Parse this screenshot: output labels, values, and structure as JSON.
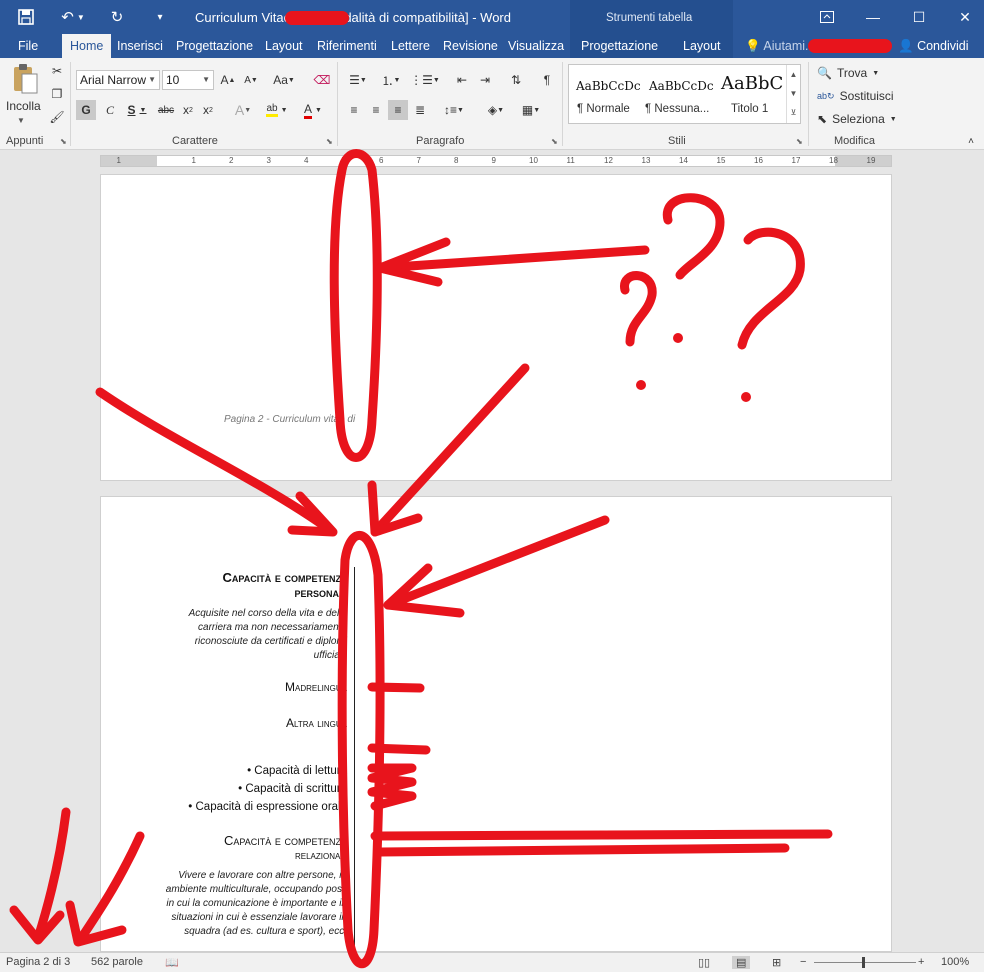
{
  "window": {
    "title": "Curriculum Vitae            .doc [Modalità di compatibilità] - Word",
    "context_title": "Strumenti tabella"
  },
  "tabs": {
    "file": "File",
    "home": "Home",
    "insert": "Inserisci",
    "design": "Progettazione",
    "layout": "Layout",
    "references": "Riferimenti",
    "mailings": "Lettere",
    "review": "Revisione",
    "view": "Visualizza",
    "table_design": "Progettazione",
    "table_layout": "Layout",
    "tell_me": "Aiutami...",
    "share": "Condividi"
  },
  "ribbon": {
    "clipboard": {
      "label": "Appunti",
      "paste": "Incolla"
    },
    "font": {
      "label": "Carattere",
      "name": "Arial Narrow",
      "size": "10"
    },
    "paragraph": {
      "label": "Paragrafo"
    },
    "styles": {
      "label": "Stili",
      "items": [
        {
          "preview": "AaBbCcDc",
          "name": "¶ Normale"
        },
        {
          "preview": "AaBbCcDc",
          "name": "¶ Nessuna..."
        },
        {
          "preview": "AaBbC",
          "name": "Titolo 1"
        }
      ]
    },
    "editing": {
      "label": "Modifica",
      "find": "Trova",
      "replace": "Sostituisci",
      "select": "Seleziona"
    }
  },
  "ruler": {
    "ticks": [
      "1",
      "1",
      "2",
      "3",
      "4",
      "5",
      "6",
      "7",
      "8",
      "9",
      "10",
      "11",
      "12",
      "13",
      "14",
      "15",
      "16",
      "17",
      "18",
      "19"
    ]
  },
  "page1": {
    "footer": "Pagina 2 - Curriculum vitae di"
  },
  "page2": {
    "heading1_a": "Capacità e competenze",
    "heading1_b": "personali",
    "desc1": [
      "Acquisite nel corso della vita e della",
      "carriera ma non necessariamente",
      "riconosciute da certificati e diplomi",
      "ufficiali."
    ],
    "mother_tongue": "Madrelingua",
    "other_lang": "Altra lingua",
    "bullets": [
      "• Capacità di lettura",
      "• Capacità di scrittura",
      "• Capacità di espressione orale"
    ],
    "heading2_a": "Capacità e competenze",
    "heading2_b": "relazionali",
    "desc2": [
      "Vivere e lavorare con altre persone, in",
      "ambiente multiculturale, occupando posti",
      "in cui la comunicazione è importante e in",
      "situazioni in cui è essenziale lavorare in",
      "squadra (ad es. cultura e sport), ecc."
    ]
  },
  "status": {
    "page": "Pagina 2 di 3",
    "words": "562 parole",
    "zoom": "100%"
  },
  "colors": {
    "accent": "#2b579a",
    "annotation": "#e8141c"
  }
}
